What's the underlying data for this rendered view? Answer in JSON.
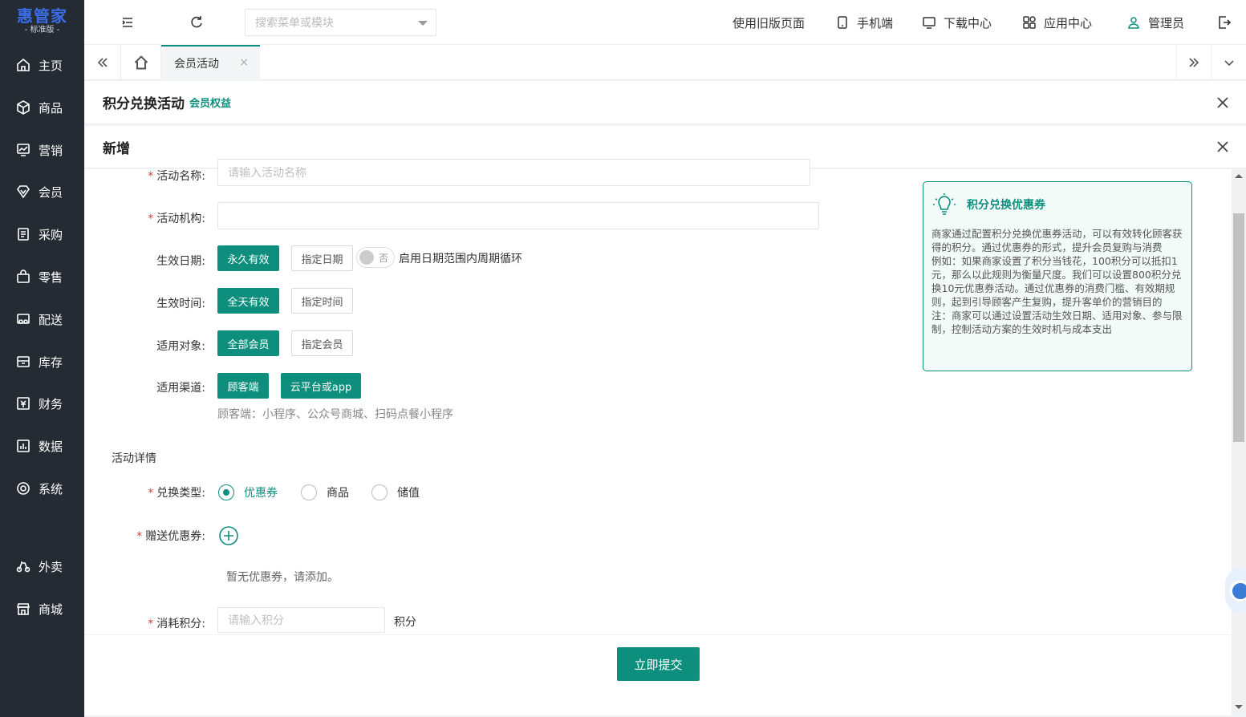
{
  "app": {
    "logo": "惠管家",
    "logo_sub": "- 标准版 -"
  },
  "sidebar": {
    "items": [
      {
        "label": "主页",
        "icon": "home-icon"
      },
      {
        "label": "商品",
        "icon": "box-icon"
      },
      {
        "label": "营销",
        "icon": "chart-icon"
      },
      {
        "label": "会员",
        "icon": "diamond-icon"
      },
      {
        "label": "采购",
        "icon": "receipt-icon"
      },
      {
        "label": "零售",
        "icon": "bag-icon"
      },
      {
        "label": "配送",
        "icon": "truck-icon"
      },
      {
        "label": "库存",
        "icon": "inventory-icon"
      },
      {
        "label": "财务",
        "icon": "finance-icon"
      },
      {
        "label": "数据",
        "icon": "data-icon"
      },
      {
        "label": "系统",
        "icon": "settings-icon"
      },
      {
        "label": "外卖",
        "icon": "delivery-icon"
      },
      {
        "label": "商城",
        "icon": "store-icon"
      }
    ]
  },
  "topbar": {
    "search_placeholder": "搜索菜单或模块",
    "old_page": "使用旧版页面",
    "mobile": "手机端",
    "download": "下载中心",
    "apps": "应用中心",
    "user": "管理员"
  },
  "tabs": {
    "active": "会员活动"
  },
  "panel": {
    "title": "积分兑换活动",
    "tag": "会员权益",
    "sub_title": "新增"
  },
  "form": {
    "name_label": "活动名称:",
    "name_placeholder": "请输入活动名称",
    "org_label": "活动机构:",
    "date_label": "生效日期:",
    "date_opt1": "永久有效",
    "date_opt2": "指定日期",
    "cycle_toggle": "否",
    "cycle_text": "启用日期范围内周期循环",
    "time_label": "生效时间:",
    "time_opt1": "全天有效",
    "time_opt2": "指定时间",
    "target_label": "适用对象:",
    "target_opt1": "全部会员",
    "target_opt2": "指定会员",
    "channel_label": "适用渠道:",
    "channel_opt1": "顾客端",
    "channel_opt2": "云平台或app",
    "channel_hint": "顾客端：小程序、公众号商城、扫码点餐小程序",
    "section_detail": "活动详情",
    "exchange_label": "兑换类型:",
    "exchange_opts": [
      "优惠券",
      "商品",
      "储值"
    ],
    "gift_label": "赠送优惠券:",
    "gift_empty": "暂无优惠券，请添加。",
    "points_label": "消耗积分:",
    "points_placeholder": "请输入积分",
    "points_unit": "积分",
    "submit": "立即提交"
  },
  "info": {
    "title": "积分兑换优惠券",
    "body": "商家通过配置积分兑换优惠券活动，可以有效转化顾客获得的积分。通过优惠券的形式，提升会员复购与消费\n例如：如果商家设置了积分当钱花，100积分可以抵扣1元，那么以此规则为衡量尺度。我们可以设置800积分兑换10元优惠券活动。通过优惠券的消费门槛、有效期规则，起到引导顾客产生复购，提升客单价的营销目的\n注：商家可以通过设置活动生效日期、适用对象、参与限制，控制活动方案的生效时机与成本支出"
  },
  "colors": {
    "accent": "#0e8f7e",
    "sidebar": "#242b33",
    "logo": "#3b6dea",
    "required": "#e4393c"
  }
}
